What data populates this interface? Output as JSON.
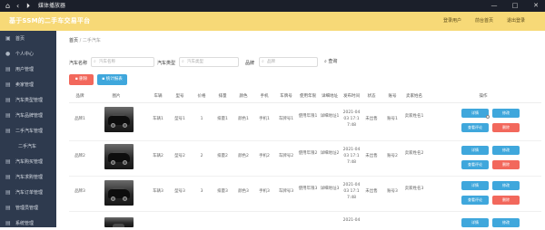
{
  "window": {
    "title": "媒体播放器",
    "minimize": "—",
    "maximize": "□",
    "close": "✕"
  },
  "header": {
    "app_title": "基于SSM的二手车交易平台",
    "links": [
      "登录用户",
      "前台首页",
      "退出登录"
    ]
  },
  "sidebar": {
    "items": [
      {
        "label": "首页",
        "icon": "home-icon",
        "glyph": "▣"
      },
      {
        "label": "个人中心",
        "icon": "user-icon",
        "glyph": "●"
      },
      {
        "label": "用户管理",
        "icon": "users-icon",
        "glyph": "▤"
      },
      {
        "label": "卖家管理",
        "icon": "seller-icon",
        "glyph": "▤"
      },
      {
        "label": "汽车类型管理",
        "icon": "category-icon",
        "glyph": "▤"
      },
      {
        "label": "汽车品牌管理",
        "icon": "brand-icon",
        "glyph": "▤"
      },
      {
        "label": "二手汽车管理",
        "icon": "car-icon",
        "glyph": "▤"
      },
      {
        "label": "二手汽车",
        "icon": "car2-icon",
        "glyph": ""
      },
      {
        "label": "汽车购买管理",
        "icon": "purchase-icon",
        "glyph": "▤"
      },
      {
        "label": "汽车求购管理",
        "icon": "request-icon",
        "glyph": "▤"
      },
      {
        "label": "汽车订单管理",
        "icon": "order-icon",
        "glyph": "▤"
      },
      {
        "label": "管理员管理",
        "icon": "admin-icon",
        "glyph": "▤"
      },
      {
        "label": "系统管理",
        "icon": "settings-icon",
        "glyph": "▤"
      }
    ]
  },
  "breadcrumb": {
    "home": "首页",
    "sep": "/",
    "current": "二手汽车"
  },
  "search": {
    "name_label": "汽车名称",
    "name_placeholder": "汽车名称",
    "type_label": "汽车类型",
    "type_placeholder": "汽车类型",
    "brand_label": "品牌",
    "brand_placeholder": "品牌",
    "search_button": "查询"
  },
  "actions": {
    "delete_label": "删除",
    "report_label": "统计报表"
  },
  "accent": {
    "topbar": "#f7d977",
    "sidebar": "#2e3a4e",
    "blue": "#3fa7dc",
    "red": "#f2685c"
  },
  "table": {
    "headers": [
      "品牌",
      "图片",
      "车辆",
      "型号",
      "价格",
      "排量",
      "颜色",
      "手机",
      "车牌号",
      "使用年限",
      "详细地址",
      "发布时间",
      "状态",
      "账号",
      "卖家姓名",
      "操作"
    ],
    "rows": [
      {
        "brand": "品牌1",
        "car": "车辆1",
        "model": "型号1",
        "price": "1",
        "disp": "排量1",
        "color": "颜色1",
        "phone": "手机1",
        "plate": "车牌号1",
        "years": "使用年限1",
        "addr": "详细地址1",
        "date": "2021-04",
        "time": "03 17:1",
        "time2": "7:48",
        "status": "未出售",
        "account": "账号1",
        "seller": "卖家姓名1"
      },
      {
        "brand": "品牌2",
        "car": "车辆2",
        "model": "型号2",
        "price": "2",
        "disp": "排量2",
        "color": "颜色2",
        "phone": "手机2",
        "plate": "车牌号2",
        "years": "使用年限2",
        "addr": "详细地址2",
        "date": "2021-04",
        "time": "03 17:1",
        "time2": "7:48",
        "status": "未出售",
        "account": "账号2",
        "seller": "卖家姓名2"
      },
      {
        "brand": "品牌3",
        "car": "车辆3",
        "model": "型号3",
        "price": "3",
        "disp": "排量3",
        "color": "颜色3",
        "phone": "手机3",
        "plate": "车牌号3",
        "years": "使用年限3",
        "addr": "详细地址3",
        "date": "2021-04",
        "time": "03 17:1",
        "time2": "7:48",
        "status": "未出售",
        "account": "账号3",
        "seller": "卖家姓名3"
      },
      {
        "date": "2021-04"
      }
    ],
    "op_buttons": {
      "detail": "详情",
      "edit": "修改",
      "review": "查看评论",
      "delete": "删除"
    }
  }
}
